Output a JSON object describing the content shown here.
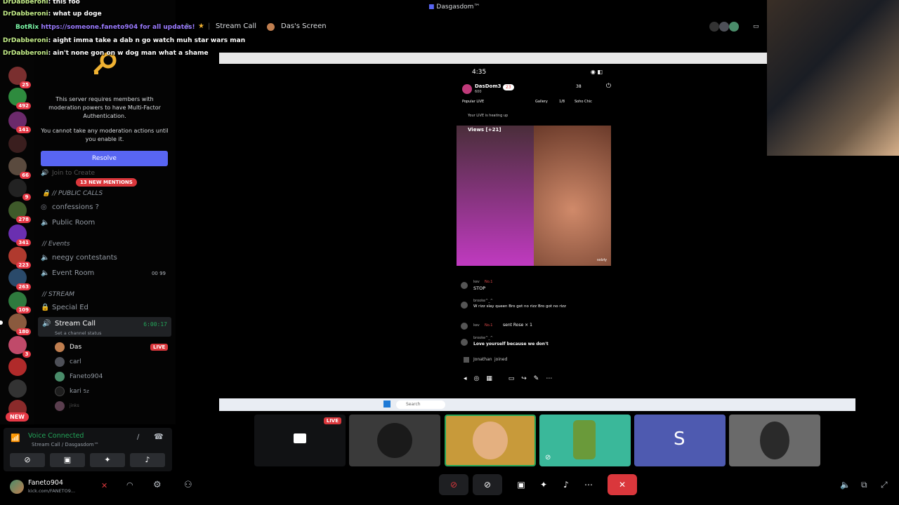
{
  "window": {
    "title": "Dasgasdom™"
  },
  "chat_overlay": [
    {
      "name": "DrDabberoni",
      "text": ": this foo"
    },
    {
      "name": "DrDabberoni",
      "text": ": what up doge"
    },
    {
      "name": "BotRix",
      "text": "https://someone.faneto904 for all updates!"
    },
    {
      "name": "DrDabberoni",
      "text": ": aight imma take a dab n go watch muh star wars man"
    },
    {
      "name": "DrDabberoni",
      "text": ": ain't none gon on w dog man what a shame"
    }
  ],
  "server_rail": {
    "badges": [
      "25",
      "492",
      "141",
      "66",
      "9",
      "278",
      "341",
      "223",
      "263",
      "109",
      "180",
      "3"
    ],
    "new_label": "NEW"
  },
  "mfa_notice": {
    "text1": "This server requires members with moderation powers to have Multi-Factor Authentication.",
    "text2": "You cannot take any moderation actions until you enable it.",
    "resolve": "Resolve"
  },
  "channels": {
    "mentions": "13 NEW MENTIONS",
    "hidden_channel": "Join to Create",
    "cat_public": "// PUBLIC CALLS",
    "confessions": "confessions ?",
    "public_room": "Public Room",
    "cat_events": "// Events",
    "neegy": "neegy contestants",
    "event_room": "Event Room",
    "event_counts": "00  99",
    "cat_stream": "// STREAM",
    "special": "Special Ed",
    "stream_call": "Stream Call",
    "stream_status": "Set a channel status",
    "stream_timer": "6:00:17"
  },
  "voice_users": [
    {
      "name": "Das",
      "live": "LIVE"
    },
    {
      "name": "carl"
    },
    {
      "name": "Faneto904"
    },
    {
      "name": "kari",
      "extra": "5z"
    },
    {
      "name": "jinks"
    }
  ],
  "voice_panel": {
    "status": "Voice Connected",
    "sub": "Stream Call / Dasgasdom™"
  },
  "user_panel": {
    "username": "Faneto904",
    "status": "kick.com/FANETO9..."
  },
  "top_bar": {
    "channel": "Stream Call",
    "screen": "Das's Screen"
  },
  "phone": {
    "time": "4:35",
    "host": "DasDom3",
    "host_likes": "600",
    "gift_count": "23",
    "viewers": "38",
    "tags": [
      "Popular LIVE",
      "Gallery",
      "1/8",
      "Soho Chic"
    ],
    "heating": "Your LIVE is heating up",
    "views": "Views [+21]",
    "watermark": "solzly",
    "comments": [
      {
        "user": "kev",
        "badge": "No.1",
        "text": "STOP"
      },
      {
        "user": "brooke^_^",
        "text": "W rizz slay queen Bro got no rizz Bro got no rizz"
      },
      {
        "user": "kev",
        "badge": "No.1",
        "text": "sent Rose × 1"
      },
      {
        "user": "brooke^_^",
        "text": "Love yourself because we don't"
      },
      {
        "user": "Jonathan",
        "text": "joined"
      }
    ]
  },
  "taskbar": {
    "search": "Search"
  },
  "tiles": {
    "live": "LIVE",
    "s_letter": "S"
  },
  "colors": {
    "accent": "#5865f2",
    "live_red": "#da373c",
    "green": "#23a559"
  }
}
